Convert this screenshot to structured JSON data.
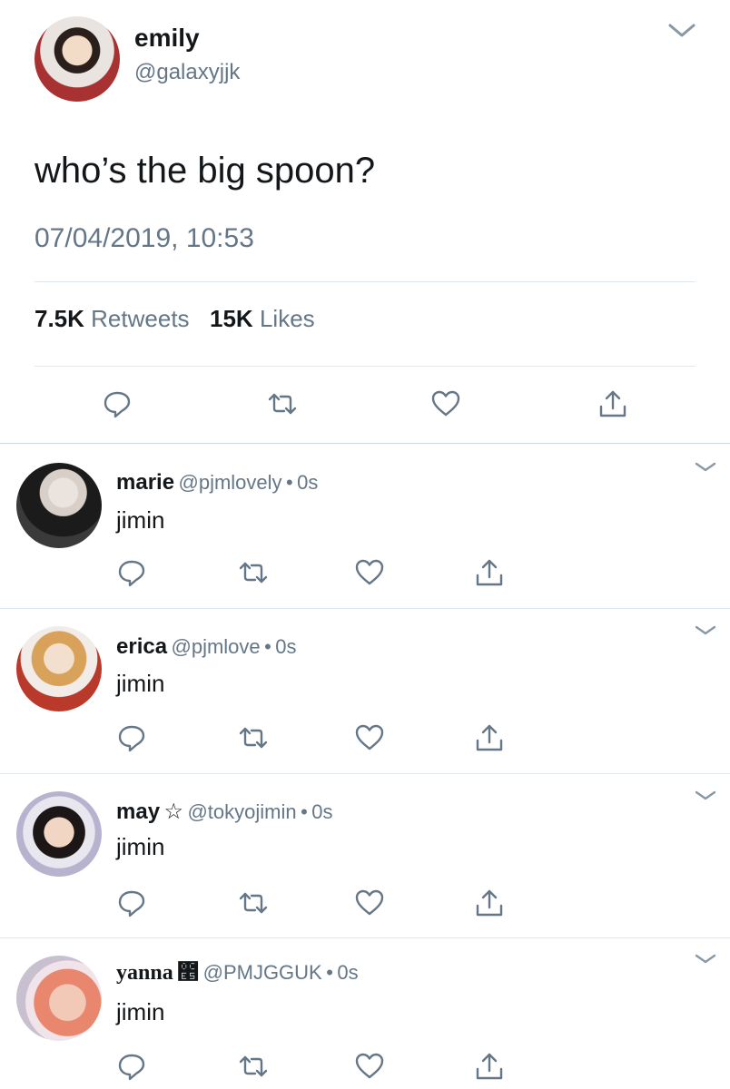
{
  "tweet": {
    "name": "emily",
    "handle": "@galaxyjjk",
    "text": "who’s the big spoon?",
    "timestamp": "07/04/2019, 10:53",
    "retweets_count": "7.5K",
    "retweets_label": "Retweets",
    "likes_count": "15K",
    "likes_label": "Likes"
  },
  "replies": [
    {
      "name": "marie",
      "badge": "",
      "handle": "@pjmlovely",
      "time": "0s",
      "text": "jimin"
    },
    {
      "name": "erica",
      "badge": "",
      "handle": "@pjmlove",
      "time": "0s",
      "text": "jimin"
    },
    {
      "name": "may",
      "badge": "☆",
      "handle": "@tokyojimin",
      "time": "0s",
      "text": "jimin"
    },
    {
      "name": "yanna",
      "badge": "೥",
      "handle": "@PMJGGUK",
      "time": "0s",
      "text": "jimin"
    }
  ],
  "separator": "•",
  "colors": {
    "text": "#14171a",
    "secondary": "#657786",
    "divider": "#e1e8ed",
    "icon": "#657786"
  },
  "icons": [
    "chevron-down-icon",
    "reply-icon",
    "retweet-icon",
    "like-icon",
    "share-icon"
  ]
}
